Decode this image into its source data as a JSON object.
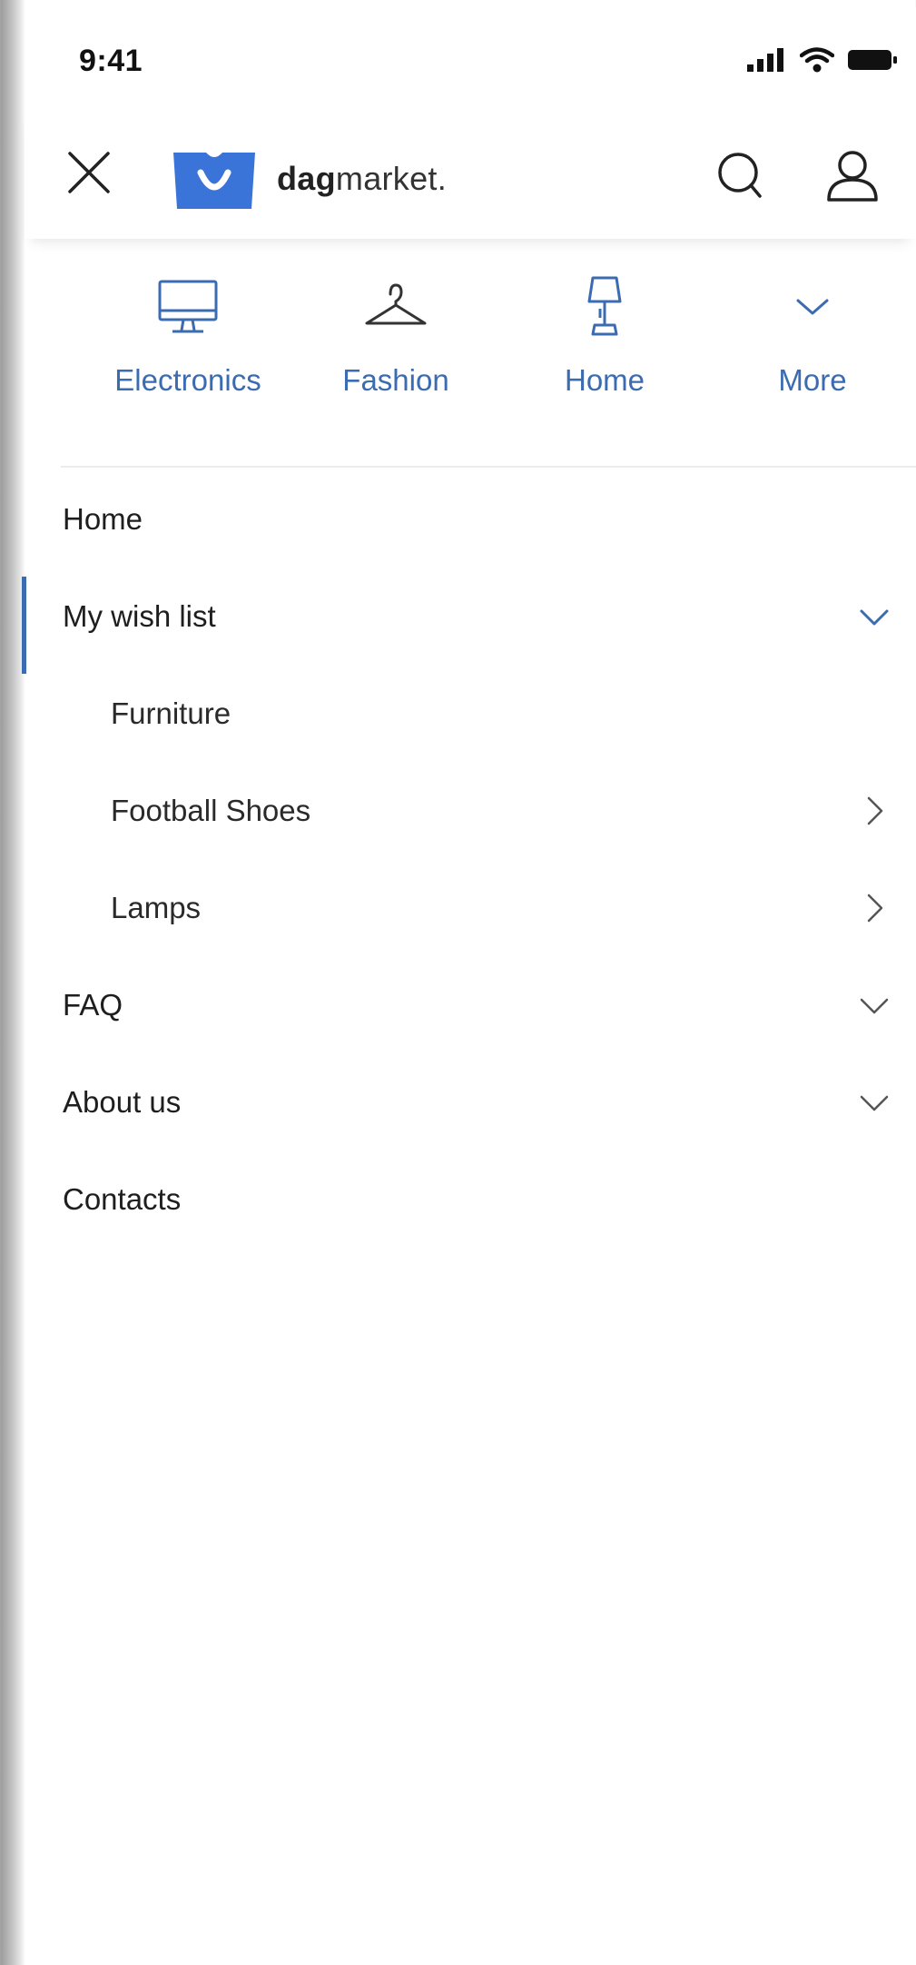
{
  "status_bar": {
    "time": "9:41"
  },
  "header": {
    "brand_bold": "dag",
    "brand_regular": "market."
  },
  "categories": [
    {
      "label": "Electronics",
      "icon": "monitor-icon"
    },
    {
      "label": "Fashion",
      "icon": "hanger-icon"
    },
    {
      "label": "Home",
      "icon": "lamp-icon"
    },
    {
      "label": "More",
      "icon": "chevron-down-icon"
    }
  ],
  "menu": {
    "items": [
      {
        "label": "Home"
      },
      {
        "label": "My wish list"
      },
      {
        "label": "Furniture"
      },
      {
        "label": "Football Shoes"
      },
      {
        "label": "Lamps"
      },
      {
        "label": "FAQ"
      },
      {
        "label": "About us"
      },
      {
        "label": "Contacts"
      }
    ]
  },
  "colors": {
    "accent": "#3b6bb0",
    "text": "#1e1e1e",
    "logo": "#3a74d8"
  }
}
